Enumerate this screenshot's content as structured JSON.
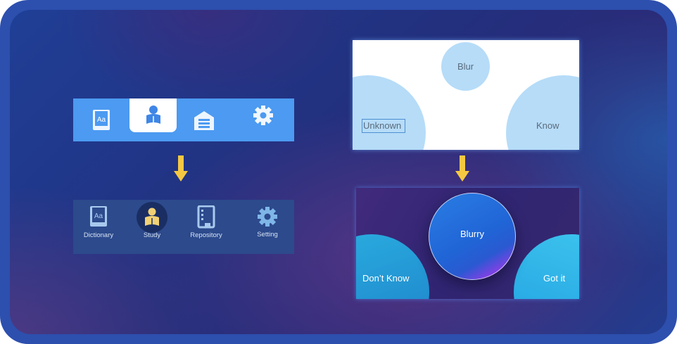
{
  "nav_old": {
    "items": [
      {
        "icon": "dictionary-icon"
      },
      {
        "icon": "study-icon",
        "active": true
      },
      {
        "icon": "repository-icon"
      },
      {
        "icon": "gear-icon"
      }
    ]
  },
  "nav_new": {
    "items": [
      {
        "label": "Dictionary",
        "icon": "dictionary-icon"
      },
      {
        "label": "Study",
        "icon": "study-icon",
        "active": true
      },
      {
        "label": "Repository",
        "icon": "repository-icon"
      },
      {
        "label": "Setting",
        "icon": "gear-icon"
      }
    ]
  },
  "card_old": {
    "center": "Blur",
    "left": "Unknown",
    "right": "Know"
  },
  "card_new": {
    "center": "Blurry",
    "left": "Don’t Know",
    "right": "Got it"
  },
  "colors": {
    "frame": "#2d4fae",
    "old_bar": "#4c9af1",
    "new_bar": "#2c4a8c",
    "arrow": "#f5c842",
    "icon_light": "#a9c9ee",
    "study_accent": "#f2d175"
  }
}
